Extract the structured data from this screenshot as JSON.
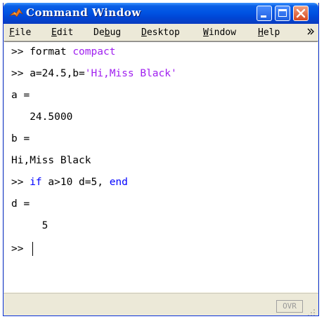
{
  "window": {
    "title": "Command Window",
    "icon": "matlab-logo-icon",
    "controls": [
      "minimize-icon",
      "maximize-icon",
      "close-icon"
    ]
  },
  "menu": {
    "items": [
      {
        "label_u": "F",
        "label_rest": "ile"
      },
      {
        "label_u": "E",
        "label_rest": "dit"
      },
      {
        "label_pre": "De",
        "label_u": "b",
        "label_rest": "ug"
      },
      {
        "label_u": "D",
        "label_rest": "esktop"
      },
      {
        "label_u": "W",
        "label_rest": "indow"
      },
      {
        "label_u": "H",
        "label_rest": "elp"
      }
    ],
    "overflow_icon": "chevron-double-icon"
  },
  "console": {
    "line1": {
      "prompt": ">> ",
      "cmd": "format ",
      "arg": "compact"
    },
    "line2": {
      "prompt": ">> ",
      "cmd": "a=24.5,b=",
      "str": "'Hi,Miss Black'"
    },
    "line3": "a =",
    "line4": "   24.5000",
    "line5": "b =",
    "line6": "Hi,Miss Black",
    "line7": {
      "prompt": ">> ",
      "kw1": "if",
      "mid": " a>10 d=5, ",
      "kw2": "end"
    },
    "line8": "d =",
    "line9": "     5",
    "line10": {
      "prompt": ">> "
    }
  },
  "status": {
    "ovr": "OVR"
  },
  "colors": {
    "keyword": "#0000ff",
    "string": "#a020f0",
    "titlebar": "#0054e3"
  }
}
